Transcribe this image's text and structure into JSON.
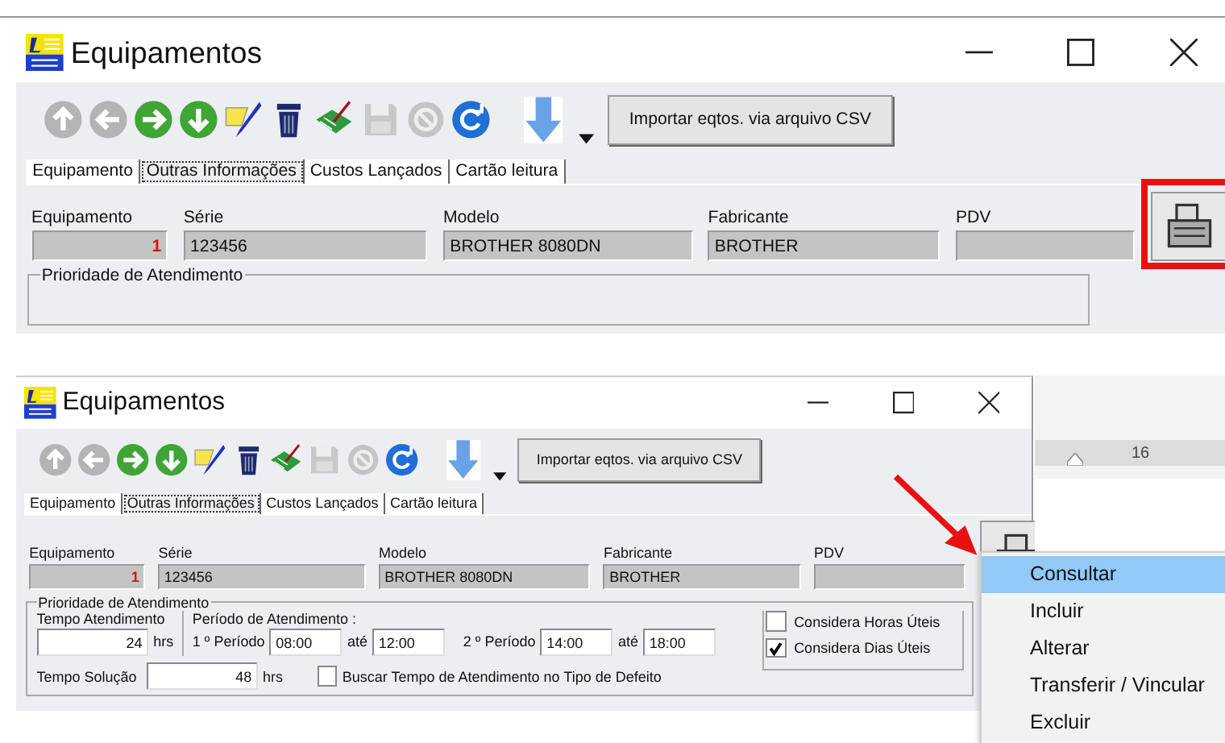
{
  "windows": [
    {
      "kind": "large",
      "title": "Equipamentos",
      "toolbar": [
        {
          "kind": "up",
          "disabled": true
        },
        {
          "kind": "left",
          "disabled": true
        },
        {
          "kind": "right",
          "disabled": false
        },
        {
          "kind": "down",
          "disabled": false
        },
        {
          "kind": "edit",
          "disabled": false
        },
        {
          "kind": "delete",
          "disabled": false
        },
        {
          "kind": "notes",
          "disabled": false
        },
        {
          "kind": "save",
          "disabled": true
        },
        {
          "kind": "cancel",
          "disabled": true
        },
        {
          "kind": "refresh",
          "disabled": false
        }
      ],
      "import_button": "Importar eqtos. via arquivo CSV",
      "tabs": [
        {
          "label": "Equipamento",
          "selected": false
        },
        {
          "label": "Outras Informações",
          "selected": true
        },
        {
          "label": "Custos Lançados",
          "selected": false
        },
        {
          "label": "Cartão leitura",
          "selected": false
        }
      ],
      "fields": [
        {
          "label": "Equipamento",
          "value": "1"
        },
        {
          "label": "Série",
          "value": "123456"
        },
        {
          "label": "Modelo",
          "value": "BROTHER 8080DN"
        },
        {
          "label": "Fabricante",
          "value": "BROTHER"
        },
        {
          "label": "PDV"
        }
      ],
      "lookup_highlighted": true,
      "priority": {
        "title": "Prioridade de Atendimento"
      }
    },
    {
      "kind": "small",
      "title": "Equipamentos",
      "toolbar": [
        {
          "kind": "up",
          "disabled": true
        },
        {
          "kind": "left",
          "disabled": true
        },
        {
          "kind": "right",
          "disabled": false
        },
        {
          "kind": "down",
          "disabled": false
        },
        {
          "kind": "edit",
          "disabled": false
        },
        {
          "kind": "delete",
          "disabled": false
        },
        {
          "kind": "notes",
          "disabled": false
        },
        {
          "kind": "save",
          "disabled": true
        },
        {
          "kind": "cancel",
          "disabled": true
        },
        {
          "kind": "refresh",
          "disabled": false
        }
      ],
      "import_button": "Importar eqtos. via arquivo CSV",
      "tabs": [
        {
          "label": "Equipamento",
          "selected": false
        },
        {
          "label": "Outras Informações",
          "selected": true
        },
        {
          "label": "Custos Lançados",
          "selected": false
        },
        {
          "label": "Cartão leitura",
          "selected": false
        }
      ],
      "fields": [
        {
          "label": "Equipamento",
          "value": "1"
        },
        {
          "label": "Série",
          "value": "123456"
        },
        {
          "label": "Modelo",
          "value": "BROTHER 8080DN"
        },
        {
          "label": "Fabricante",
          "value": "BROTHER"
        },
        {
          "label": "PDV"
        }
      ],
      "lookup_highlighted": false,
      "priority": {
        "title": "Prioridade de Atendimento",
        "tempo_atendimento": {
          "label": "Tempo Atendimento",
          "value": "24",
          "unit": "hrs"
        },
        "periodo_title": "Período de Atendimento :",
        "periods": [
          {
            "label": "1 º Período",
            "from": "08:00",
            "sep": "até",
            "to": "12:00"
          },
          {
            "label": "2 º Período",
            "from": "14:00",
            "sep": "até",
            "to": "18:00"
          }
        ],
        "checks": [
          {
            "label": "Considera Horas Úteis",
            "checked": false
          },
          {
            "label": "Considera Dias Úteis",
            "checked": true
          }
        ],
        "tempo_solucao": {
          "label": "Tempo Solução",
          "value": "48",
          "unit": "hrs"
        },
        "buscar": {
          "label": "Buscar Tempo de Atendimento no Tipo de Defeito",
          "checked": false
        }
      }
    }
  ],
  "ruler": {
    "label": "16"
  },
  "context_menu": {
    "items": [
      {
        "label": "Consultar",
        "selected": true
      },
      {
        "label": "Incluir",
        "selected": false
      },
      {
        "label": "Alterar",
        "selected": false
      },
      {
        "label": "Transferir / Vincular",
        "selected": false
      },
      {
        "label": "Excluir",
        "selected": false
      }
    ]
  }
}
